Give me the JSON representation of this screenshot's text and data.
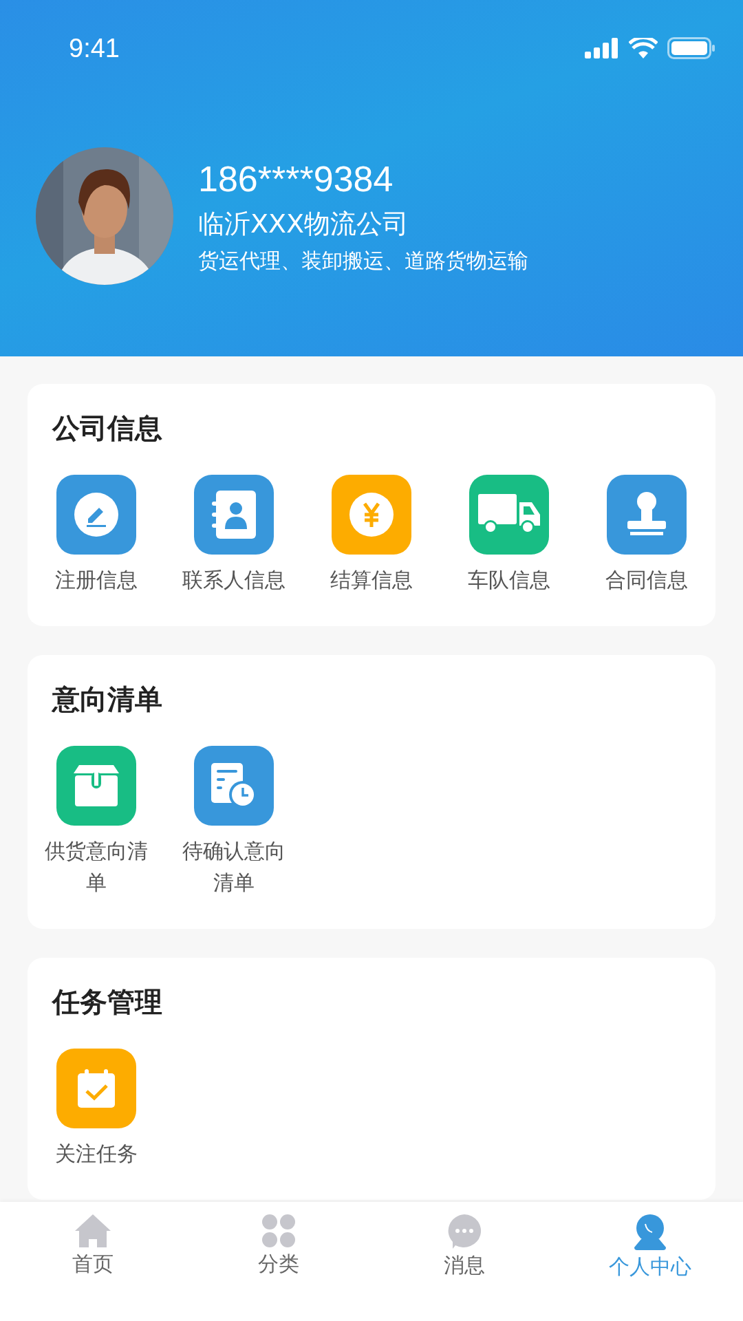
{
  "status_bar": {
    "time": "9:41"
  },
  "profile": {
    "phone": "186****9384",
    "company": "临沂XXX物流公司",
    "business_scope": "货运代理、装卸搬运、道路货物运输"
  },
  "sections": [
    {
      "title": "公司信息",
      "items": [
        {
          "label": "注册信息",
          "color": "#3897db"
        },
        {
          "label": "联系人信息",
          "color": "#3897db"
        },
        {
          "label": "结算信息",
          "color": "#fdac00"
        },
        {
          "label": "车队信息",
          "color": "#18bd84"
        },
        {
          "label": "合同信息",
          "color": "#3897db"
        }
      ]
    },
    {
      "title": "意向清单",
      "items": [
        {
          "label": "供货意向清单",
          "color": "#18bd84"
        },
        {
          "label": "待确认意向清单",
          "color": "#3897db"
        }
      ]
    },
    {
      "title": "任务管理",
      "items": [
        {
          "label": "关注任务",
          "color": "#fdac00"
        }
      ]
    }
  ],
  "tab_bar": [
    {
      "label": "首页",
      "selected": false
    },
    {
      "label": "分类",
      "selected": false
    },
    {
      "label": "消息",
      "selected": false
    },
    {
      "label": "个人中心",
      "selected": true
    }
  ]
}
